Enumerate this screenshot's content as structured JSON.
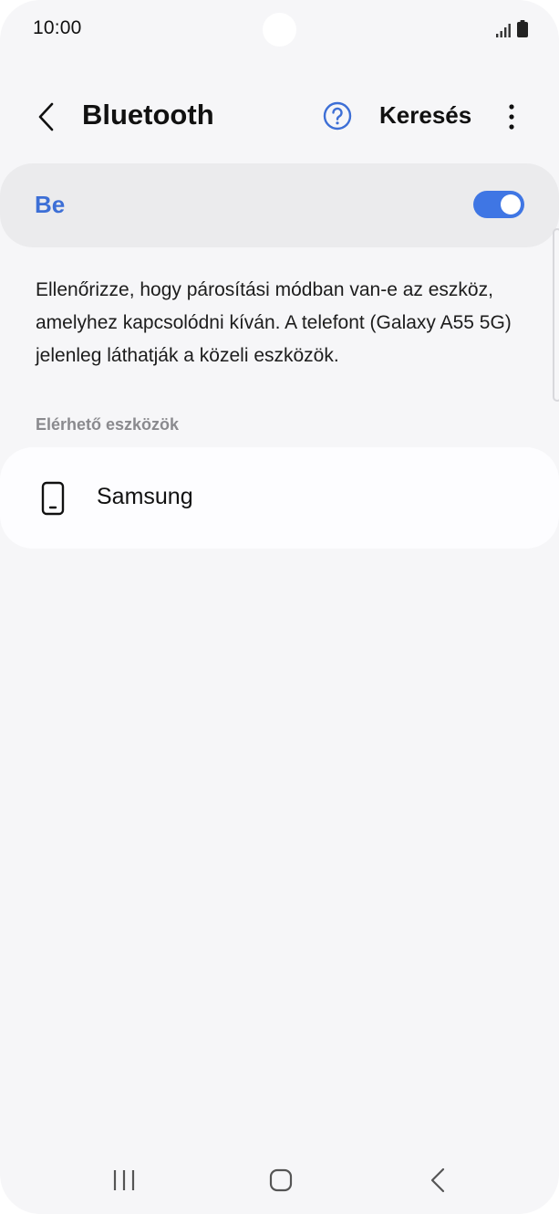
{
  "status_bar": {
    "time": "10:00",
    "icons": [
      "signal-icon",
      "battery-icon"
    ]
  },
  "header": {
    "title": "Bluetooth",
    "back_icon": "chevron-left-icon",
    "help_icon": "help-circle-icon",
    "search_label": "Keresés",
    "more_icon": "more-vertical-icon"
  },
  "toggle": {
    "label": "Be",
    "state": "on",
    "accent_color": "#3f76e4",
    "label_color": "#3d6fd6"
  },
  "info_text": "Ellenőrizze, hogy párosítási módban van-e az eszköz, amelyhez kapcsolódni kíván. A telefont (Galaxy A55 5G) jelenleg láthatják a közeli eszközök.",
  "available_section": {
    "label": "Elérhető eszközök",
    "devices": [
      {
        "name": "Samsung",
        "icon": "smartphone-icon"
      }
    ]
  },
  "nav_bar": {
    "icons": [
      "recent-apps-icon",
      "home-icon",
      "back-icon"
    ]
  }
}
